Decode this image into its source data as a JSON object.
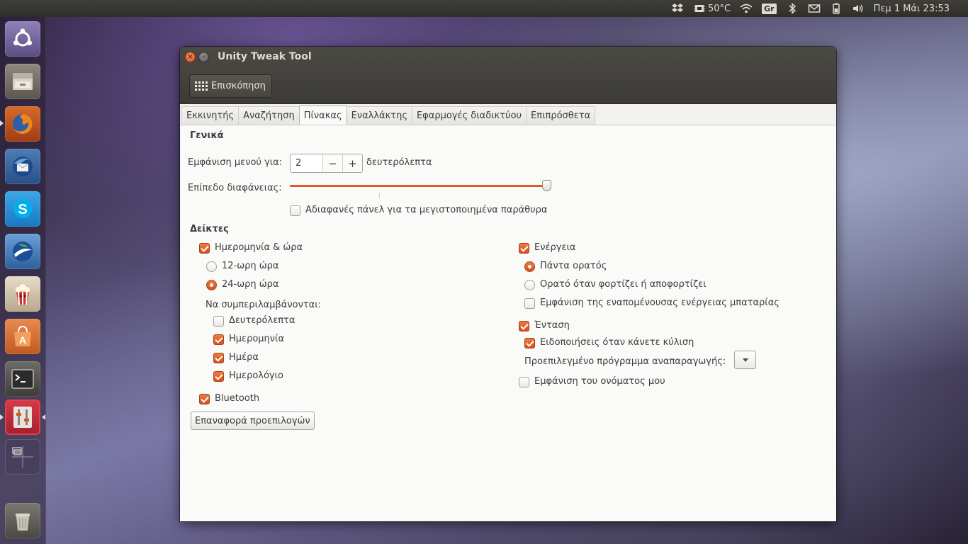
{
  "panel": {
    "temperature": "50°C",
    "keyboard_layout": "Gr",
    "datetime": "Πεμ  1 Μάι 23:53"
  },
  "window": {
    "title": "Unity Tweak Tool",
    "close_glyph": "×",
    "minimize_glyph": "–",
    "overview_label": "Επισκόπηση"
  },
  "tabs": [
    {
      "label": "Εκκινητής"
    },
    {
      "label": "Αναζήτηση"
    },
    {
      "label": "Πίνακας"
    },
    {
      "label": "Εναλλάκτης"
    },
    {
      "label": "Εφαρμογές διαδικτύου"
    },
    {
      "label": "Επιπρόσθετα"
    }
  ],
  "active_tab": "Πίνακας",
  "general": {
    "title": "Γενικά",
    "menu_time_label": "Εμφάνιση μενού για:",
    "menu_time_value": "2",
    "minus": "−",
    "plus": "+",
    "menu_time_unit": "δευτερόλεπτα",
    "transparency_label": "Επίπεδο διαφάνειας:",
    "transparency_level": 0.99,
    "opaque_panels_label": "Αδιαφανές πάνελ για τα μεγιστοποιημένα παράθυρα",
    "opaque_panels_checked": false
  },
  "indicators": {
    "title": "Δείκτες",
    "datetime": {
      "label": "Ημερομηνία & ώρα",
      "checked": true,
      "format_12": "12-ωρη ώρα",
      "format_24": "24-ωρη ώρα",
      "selected_format": "24-ωρη ώρα",
      "include_label": "Να συμπεριλαμβάνονται:",
      "seconds": "Δευτερόλεπτα",
      "seconds_checked": false,
      "date": "Ημερομηνία",
      "date_checked": true,
      "weekday": "Ημέρα",
      "weekday_checked": true,
      "calendar": "Ημερολόγιο",
      "calendar_checked": true
    },
    "bluetooth": {
      "label": "Bluetooth",
      "checked": true
    },
    "power": {
      "label": "Ενέργεια",
      "checked": true,
      "always_visible": "Πάντα ορατός",
      "visible_charging": "Ορατό όταν φορτίζει ή αποφορτίζει",
      "selected": "Πάντα ορατός",
      "show_remaining": "Εμφάνιση της εναπομένουσας ενέργειας μπαταρίας",
      "show_remaining_checked": false
    },
    "volume": {
      "label": "Ένταση",
      "checked": true,
      "notify_scroll": "Ειδοποιήσεις όταν κάνετε κύλιση",
      "notify_scroll_checked": true,
      "default_player_label": "Προεπιλεγμένο πρόγραμμα αναπαραγωγής:",
      "default_player_value": ""
    },
    "show_name": {
      "label": "Εμφάνιση του ονόματος μου",
      "checked": false
    }
  },
  "reset_label": "Επαναφορά προεπιλογών",
  "colors": {
    "accent": "#e05a22",
    "titlebar": "#3c3b37",
    "panel": "#2f2e2a"
  },
  "launcher_icons": [
    "ubuntu-dash-icon",
    "files-icon",
    "firefox-icon",
    "thunderbird-icon",
    "skype-icon",
    "google-earth-icon",
    "popcorn-time-icon",
    "software-center-icon",
    "terminal-icon",
    "unity-tweak-tool-icon",
    "workspace-switcher-icon",
    "trash-icon"
  ]
}
